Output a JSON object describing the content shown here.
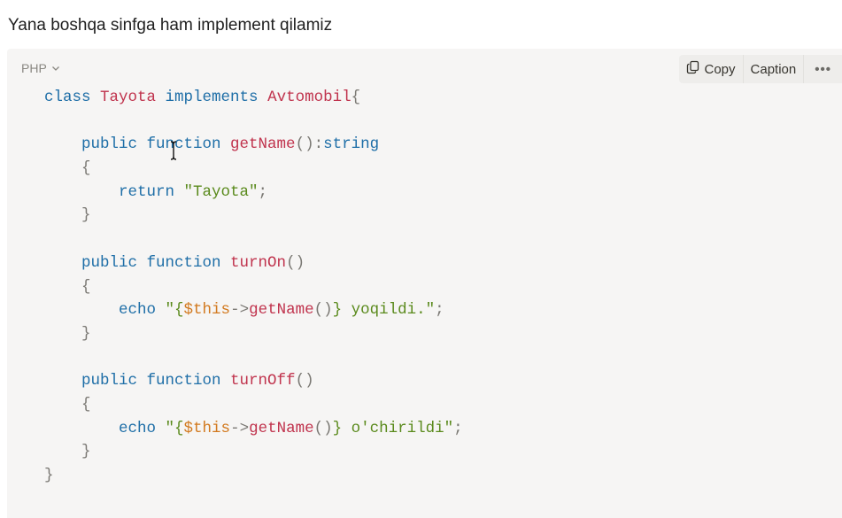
{
  "intro_text": "Yana boshqa sinfga ham implement qilamiz",
  "code_block": {
    "language": "PHP",
    "toolbar": {
      "copy_label": "Copy",
      "caption_label": "Caption",
      "more_label": "•••"
    },
    "lines": [
      [
        {
          "t": "kw",
          "v": "class "
        },
        {
          "t": "fn",
          "v": "Tayota "
        },
        {
          "t": "kw",
          "v": "implements "
        },
        {
          "t": "fn",
          "v": "Avtomobil"
        },
        {
          "t": "punc",
          "v": "{"
        }
      ],
      [],
      [
        {
          "t": "txt",
          "v": "    "
        },
        {
          "t": "kw",
          "v": "public function "
        },
        {
          "t": "fn",
          "v": "getName"
        },
        {
          "t": "punc",
          "v": "():"
        },
        {
          "t": "kw",
          "v": "string"
        }
      ],
      [
        {
          "t": "txt",
          "v": "    "
        },
        {
          "t": "punc",
          "v": "{"
        }
      ],
      [
        {
          "t": "txt",
          "v": "        "
        },
        {
          "t": "kw",
          "v": "return "
        },
        {
          "t": "str",
          "v": "\"Tayota\""
        },
        {
          "t": "punc",
          "v": ";"
        }
      ],
      [
        {
          "t": "txt",
          "v": "    "
        },
        {
          "t": "punc",
          "v": "}"
        }
      ],
      [],
      [
        {
          "t": "txt",
          "v": "    "
        },
        {
          "t": "kw",
          "v": "public function "
        },
        {
          "t": "fn",
          "v": "turnOn"
        },
        {
          "t": "punc",
          "v": "()"
        }
      ],
      [
        {
          "t": "txt",
          "v": "    "
        },
        {
          "t": "punc",
          "v": "{"
        }
      ],
      [
        {
          "t": "txt",
          "v": "        "
        },
        {
          "t": "kw",
          "v": "echo "
        },
        {
          "t": "str",
          "v": "\"{"
        },
        {
          "t": "var",
          "v": "$this"
        },
        {
          "t": "punc",
          "v": "->"
        },
        {
          "t": "fn",
          "v": "getName"
        },
        {
          "t": "punc",
          "v": "()"
        },
        {
          "t": "str",
          "v": "} yoqildi.\""
        },
        {
          "t": "punc",
          "v": ";"
        }
      ],
      [
        {
          "t": "txt",
          "v": "    "
        },
        {
          "t": "punc",
          "v": "}"
        }
      ],
      [],
      [
        {
          "t": "txt",
          "v": "    "
        },
        {
          "t": "kw",
          "v": "public function "
        },
        {
          "t": "fn",
          "v": "turnOff"
        },
        {
          "t": "punc",
          "v": "()"
        }
      ],
      [
        {
          "t": "txt",
          "v": "    "
        },
        {
          "t": "punc",
          "v": "{"
        }
      ],
      [
        {
          "t": "txt",
          "v": "        "
        },
        {
          "t": "kw",
          "v": "echo "
        },
        {
          "t": "str",
          "v": "\"{"
        },
        {
          "t": "var",
          "v": "$this"
        },
        {
          "t": "punc",
          "v": "->"
        },
        {
          "t": "fn",
          "v": "getName"
        },
        {
          "t": "punc",
          "v": "()"
        },
        {
          "t": "str",
          "v": "} o'chirildi\""
        },
        {
          "t": "punc",
          "v": ";"
        }
      ],
      [
        {
          "t": "txt",
          "v": "    "
        },
        {
          "t": "punc",
          "v": "}"
        }
      ],
      [
        {
          "t": "punc",
          "v": "}"
        }
      ]
    ]
  },
  "icons": {
    "language_chevron": "chevron-down-icon",
    "copy": "copy-icon",
    "cursor": "text-cursor-icon"
  },
  "colors": {
    "keyword": "#1e6ea7",
    "function": "#c0334d",
    "string": "#5a8a1c",
    "variable": "#d2791e",
    "block_bg": "#f6f5f4"
  }
}
